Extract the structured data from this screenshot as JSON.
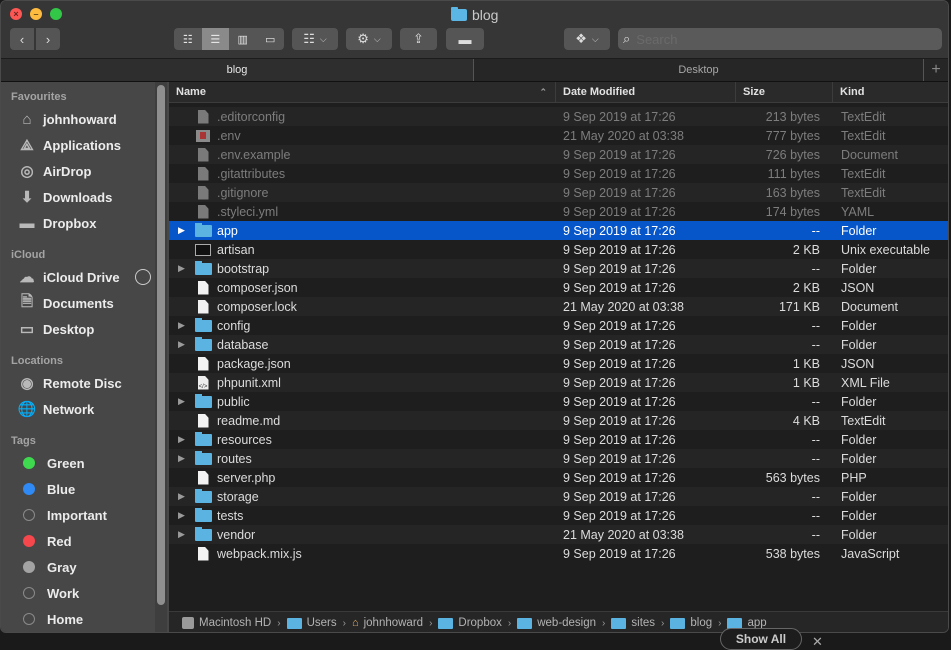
{
  "window": {
    "title": "blog",
    "traffic_lights": [
      "close",
      "minimize",
      "fullscreen"
    ]
  },
  "toolbar": {
    "back_icon": "chevron-left-icon",
    "forward_icon": "chevron-right-icon",
    "view_modes": [
      "icon",
      "list",
      "column",
      "gallery"
    ],
    "active_view": "list",
    "arrange_icon": "grid-arrange-icon",
    "action_icon": "gear-icon",
    "share_icon": "share-icon",
    "tags_icon": "tag-icon",
    "dropbox_icon": "dropbox-icon",
    "search_placeholder": "Search"
  },
  "tabs": [
    {
      "label": "blog",
      "active": true
    },
    {
      "label": "Desktop",
      "active": false
    }
  ],
  "sidebar": {
    "sections": [
      {
        "title": "Favourites",
        "items": [
          {
            "label": "johnhoward",
            "icon": "home-icon"
          },
          {
            "label": "Applications",
            "icon": "applications-icon"
          },
          {
            "label": "AirDrop",
            "icon": "airdrop-icon"
          },
          {
            "label": "Downloads",
            "icon": "downloads-icon"
          },
          {
            "label": "Dropbox",
            "icon": "folder-icon"
          }
        ]
      },
      {
        "title": "iCloud",
        "items": [
          {
            "label": "iCloud Drive",
            "icon": "cloud-icon"
          },
          {
            "label": "Documents",
            "icon": "documents-icon"
          },
          {
            "label": "Desktop",
            "icon": "desktop-icon"
          }
        ]
      },
      {
        "title": "Locations",
        "items": [
          {
            "label": "Remote Disc",
            "icon": "disc-icon"
          },
          {
            "label": "Network",
            "icon": "network-icon"
          }
        ]
      },
      {
        "title": "Tags",
        "items": [
          {
            "label": "Green",
            "color": "#3fd94f"
          },
          {
            "label": "Blue",
            "color": "#2f8af5"
          },
          {
            "label": "Important",
            "color": ""
          },
          {
            "label": "Red",
            "color": "#f5474c"
          },
          {
            "label": "Gray",
            "color": "#a3a3a3"
          },
          {
            "label": "Work",
            "color": ""
          },
          {
            "label": "Home",
            "color": ""
          }
        ]
      }
    ]
  },
  "columns": {
    "name": "Name",
    "date": "Date Modified",
    "size": "Size",
    "kind": "Kind"
  },
  "files": [
    {
      "name": ".editorconfig",
      "date": "9 Sep 2019 at 17:26",
      "size": "213 bytes",
      "kind": "TextEdit",
      "type": "doc",
      "hidden": true
    },
    {
      "name": ".env",
      "date": "21 May 2020 at 03:38",
      "size": "777 bytes",
      "kind": "TextEdit",
      "type": "env",
      "hidden": true
    },
    {
      "name": ".env.example",
      "date": "9 Sep 2019 at 17:26",
      "size": "726 bytes",
      "kind": "Document",
      "type": "doc",
      "hidden": true
    },
    {
      "name": ".gitattributes",
      "date": "9 Sep 2019 at 17:26",
      "size": "111 bytes",
      "kind": "TextEdit",
      "type": "doc",
      "hidden": true
    },
    {
      "name": ".gitignore",
      "date": "9 Sep 2019 at 17:26",
      "size": "163 bytes",
      "kind": "TextEdit",
      "type": "doc",
      "hidden": true
    },
    {
      "name": ".styleci.yml",
      "date": "9 Sep 2019 at 17:26",
      "size": "174 bytes",
      "kind": "YAML",
      "type": "doc",
      "hidden": true
    },
    {
      "name": "app",
      "date": "9 Sep 2019 at 17:26",
      "size": "--",
      "kind": "Folder",
      "type": "folder",
      "selected": true
    },
    {
      "name": "artisan",
      "date": "9 Sep 2019 at 17:26",
      "size": "2 KB",
      "kind": "Unix executable",
      "type": "exec"
    },
    {
      "name": "bootstrap",
      "date": "9 Sep 2019 at 17:26",
      "size": "--",
      "kind": "Folder",
      "type": "folder"
    },
    {
      "name": "composer.json",
      "date": "9 Sep 2019 at 17:26",
      "size": "2 KB",
      "kind": "JSON",
      "type": "doc"
    },
    {
      "name": "composer.lock",
      "date": "21 May 2020 at 03:38",
      "size": "171 KB",
      "kind": "Document",
      "type": "doc"
    },
    {
      "name": "config",
      "date": "9 Sep 2019 at 17:26",
      "size": "--",
      "kind": "Folder",
      "type": "folder"
    },
    {
      "name": "database",
      "date": "9 Sep 2019 at 17:26",
      "size": "--",
      "kind": "Folder",
      "type": "folder"
    },
    {
      "name": "package.json",
      "date": "9 Sep 2019 at 17:26",
      "size": "1 KB",
      "kind": "JSON",
      "type": "doc"
    },
    {
      "name": "phpunit.xml",
      "date": "9 Sep 2019 at 17:26",
      "size": "1 KB",
      "kind": "XML File",
      "type": "xml"
    },
    {
      "name": "public",
      "date": "9 Sep 2019 at 17:26",
      "size": "--",
      "kind": "Folder",
      "type": "folder"
    },
    {
      "name": "readme.md",
      "date": "9 Sep 2019 at 17:26",
      "size": "4 KB",
      "kind": "TextEdit",
      "type": "doc"
    },
    {
      "name": "resources",
      "date": "9 Sep 2019 at 17:26",
      "size": "--",
      "kind": "Folder",
      "type": "folder"
    },
    {
      "name": "routes",
      "date": "9 Sep 2019 at 17:26",
      "size": "--",
      "kind": "Folder",
      "type": "folder"
    },
    {
      "name": "server.php",
      "date": "9 Sep 2019 at 17:26",
      "size": "563 bytes",
      "kind": "PHP",
      "type": "doc"
    },
    {
      "name": "storage",
      "date": "9 Sep 2019 at 17:26",
      "size": "--",
      "kind": "Folder",
      "type": "folder"
    },
    {
      "name": "tests",
      "date": "9 Sep 2019 at 17:26",
      "size": "--",
      "kind": "Folder",
      "type": "folder"
    },
    {
      "name": "vendor",
      "date": "21 May 2020 at 03:38",
      "size": "--",
      "kind": "Folder",
      "type": "folder"
    },
    {
      "name": "webpack.mix.js",
      "date": "9 Sep 2019 at 17:26",
      "size": "538 bytes",
      "kind": "JavaScript",
      "type": "doc"
    }
  ],
  "pathbar": [
    {
      "label": "Macintosh HD",
      "icon": "hard-drive-icon"
    },
    {
      "label": "Users",
      "icon": "folder-icon"
    },
    {
      "label": "johnhoward",
      "icon": "home-icon"
    },
    {
      "label": "Dropbox",
      "icon": "folder-icon"
    },
    {
      "label": "web-design",
      "icon": "folder-icon"
    },
    {
      "label": "sites",
      "icon": "folder-icon"
    },
    {
      "label": "blog",
      "icon": "folder-icon"
    },
    {
      "label": "app",
      "icon": "folder-icon"
    }
  ],
  "overlay": {
    "show_all_label": "Show All",
    "dismiss_label": "✕"
  },
  "colors": {
    "selection": "#0756c9",
    "folder": "#5ab3e0"
  }
}
